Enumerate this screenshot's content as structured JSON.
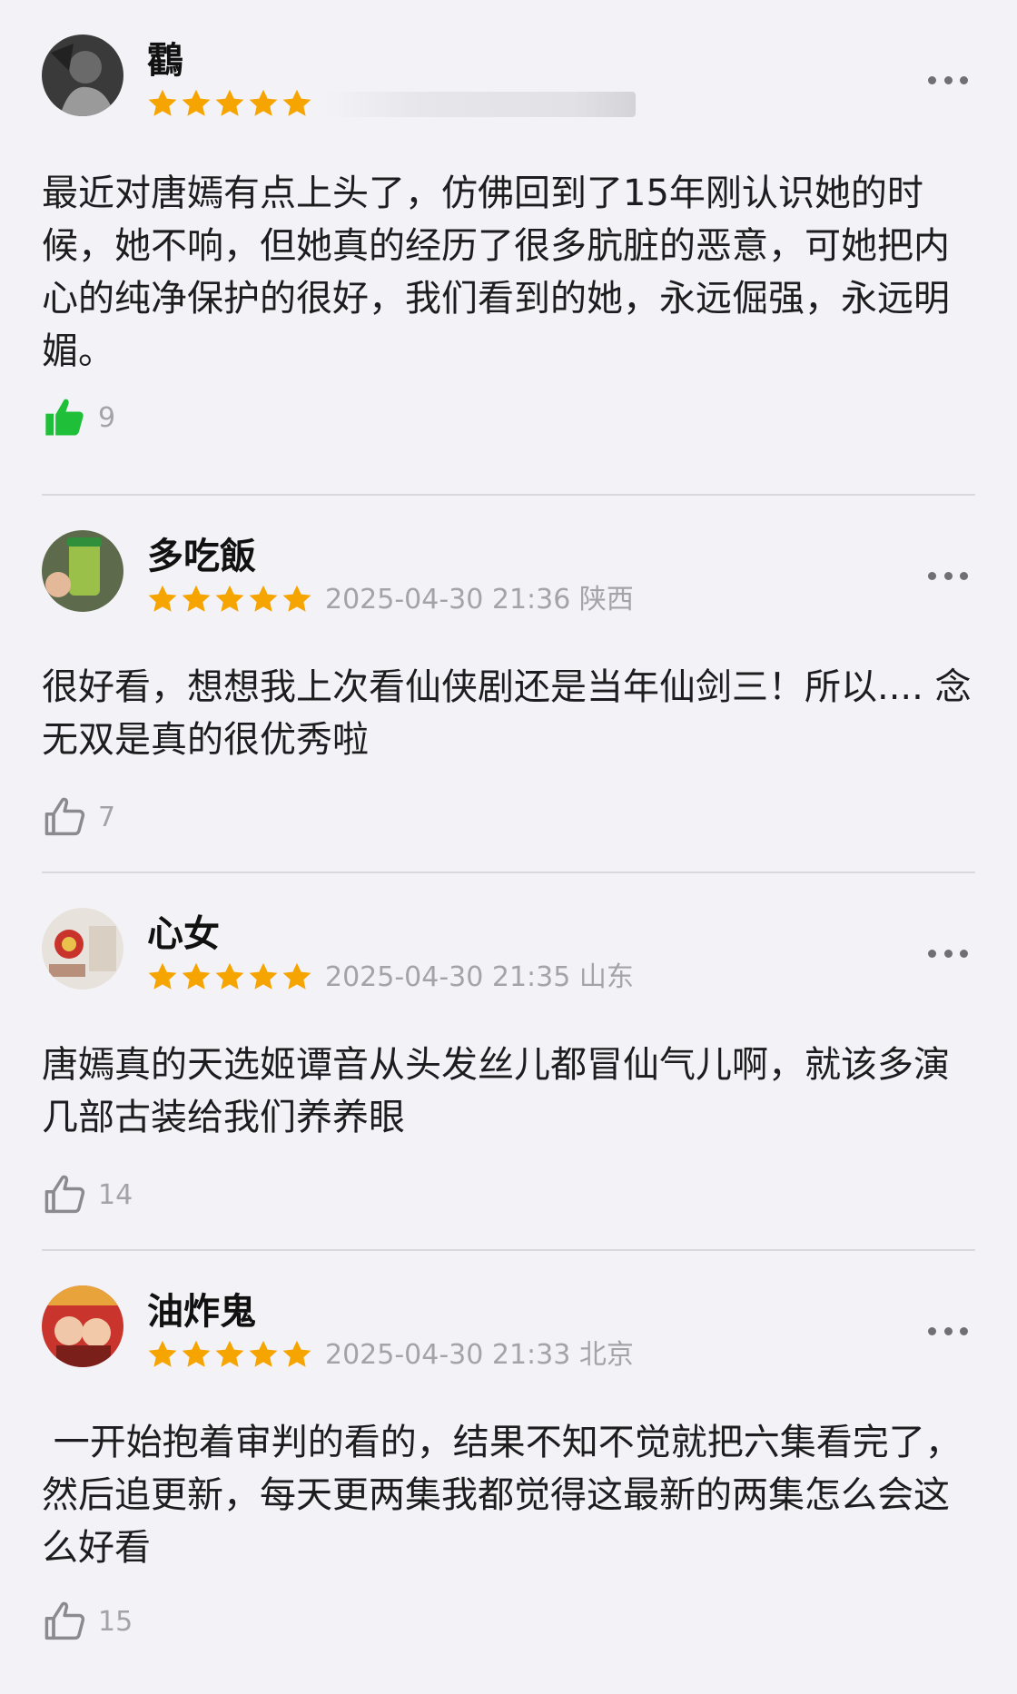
{
  "reviews": [
    {
      "username": "鸖",
      "meta": "",
      "rating": 5,
      "text": "最近对唐嫣有点上头了，仿佛回到了15年刚认识她的时候，她不响，但她真的经历了很多肮脏的恶意，可她把内心的纯净保护的很好，我们看到的她，永远倔强，永远明媚。",
      "likes": "9",
      "liked": true
    },
    {
      "username": "多吃飯",
      "meta": "2025-04-30 21:36 陕西",
      "rating": 5,
      "text": "很好看，想想我上次看仙侠剧还是当年仙剑三！所以.... 念无双是真的很优秀啦",
      "likes": "7",
      "liked": false
    },
    {
      "username": "心女",
      "meta": "2025-04-30 21:35 山东",
      "rating": 5,
      "text": "唐嫣真的天选姬谭音从头发丝儿都冒仙气儿啊，就该多演几部古装给我们养养眼",
      "likes": "14",
      "liked": false
    },
    {
      "username": "油炸鬼",
      "meta": "2025-04-30 21:33 北京",
      "rating": 5,
      "text": " 一开始抱着审判的看的，结果不知不觉就把六集看完了，然后追更新，每天更两集我都觉得这最新的两集怎么会这么好看",
      "likes": "15",
      "liked": false
    }
  ],
  "colors": {
    "star": "#f5a400",
    "like_active": "#1fbf3a",
    "like_idle": "#8a8a8f"
  },
  "icons": {
    "star": "star-icon",
    "like": "thumbs-up-icon",
    "more": "more-dots-icon"
  }
}
